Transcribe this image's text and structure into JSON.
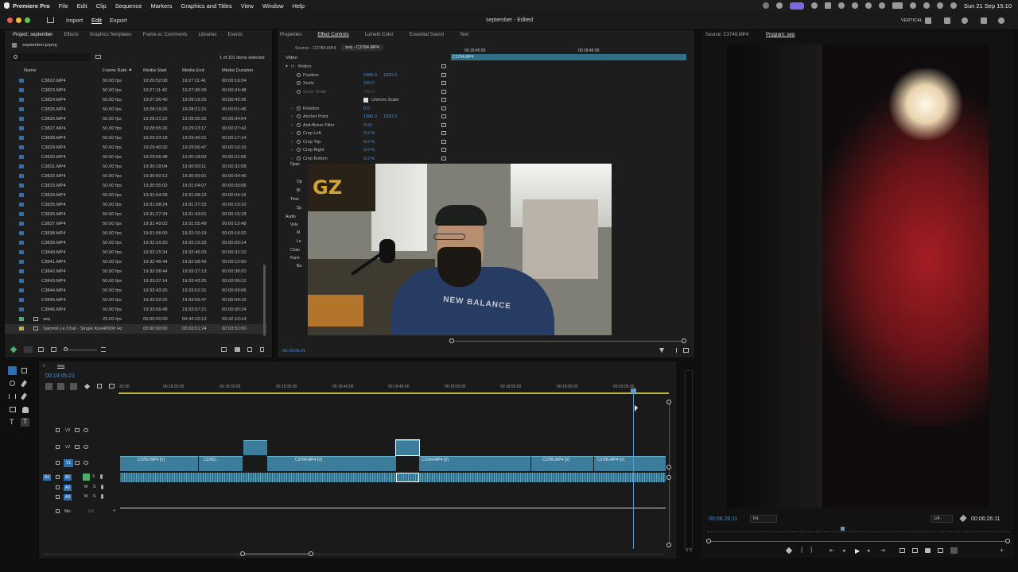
{
  "menubar": {
    "app": "Premiere Pro",
    "items": [
      "File",
      "Edit",
      "Clip",
      "Sequence",
      "Markers",
      "Graphics and Titles",
      "View",
      "Window",
      "Help"
    ],
    "clock": "Sun 21 Sep  15:10"
  },
  "titlebar": {
    "nav": [
      "Import",
      "Edit",
      "Export"
    ],
    "title": "september - Edited",
    "workspace": "VERTICAL"
  },
  "project": {
    "tabs": [
      "Project: september",
      "Effects",
      "Graphics Templates",
      "Frame.io: Comments",
      "Libraries",
      "Events"
    ],
    "file": "september.prproj",
    "count": "1 of 101 items selected",
    "columns": [
      "Name",
      "Frame Rate",
      "Media Start",
      "Media End",
      "Media Duration"
    ],
    "rows": [
      [
        "C3822.MP4",
        "50.00 fps",
        "19:26:52:08",
        "19:27:11:41",
        "00:00:19:34"
      ],
      [
        "C3823.MP4",
        "50.00 fps",
        "19:27:11:42",
        "19:27:36:39",
        "00:00:24:48"
      ],
      [
        "C3824.MP4",
        "50.00 fps",
        "19:27:36:40",
        "19:28:19:25",
        "00:00:42:36"
      ],
      [
        "C3825.MP4",
        "50.00 fps",
        "19:28:19:26",
        "19:28:21:21",
        "00:00:01:46"
      ],
      [
        "C3826.MP4",
        "50.00 fps",
        "19:28:21:22",
        "19:28:55:25",
        "00:00:34:04"
      ],
      [
        "C3827.MP4",
        "50.00 fps",
        "19:28:55:26",
        "19:29:23:17",
        "00:00:27:42"
      ],
      [
        "C3828.MP4",
        "50.00 fps",
        "19:29:23:18",
        "19:29:40:31",
        "00:00:17:14"
      ],
      [
        "C3829.MP4",
        "50.00 fps",
        "19:29:40:32",
        "19:29:56:47",
        "00:00:16:16"
      ],
      [
        "C3830.MP4",
        "50.00 fps",
        "19:29:56:48",
        "19:30:18:03",
        "00:00:21:06"
      ],
      [
        "C3831.MP4",
        "50.00 fps",
        "19:30:18:04",
        "19:30:50:11",
        "00:00:32:08"
      ],
      [
        "C3832.MP4",
        "50.00 fps",
        "19:30:50:12",
        "19:30:55:01",
        "00:00:04:40"
      ],
      [
        "C3833.MP4",
        "50.00 fps",
        "19:30:55:02",
        "19:31:04:07",
        "00:00:09:06"
      ],
      [
        "C3834.MP4",
        "50.00 fps",
        "19:31:04:08",
        "19:31:08:23",
        "00:00:04:16"
      ],
      [
        "C3835.MP4",
        "50.00 fps",
        "19:31:08:24",
        "19:31:27:33",
        "00:00:19:10"
      ],
      [
        "C3836.MP4",
        "50.00 fps",
        "19:31:27:34",
        "19:31:43:01",
        "00:00:15:18"
      ],
      [
        "C3837.MP4",
        "50.00 fps",
        "19:31:43:02",
        "19:31:55:49",
        "00:00:12:48"
      ],
      [
        "C3838.MP4",
        "50.00 fps",
        "19:31:56:00",
        "19:32:10:19",
        "00:00:14:20"
      ],
      [
        "C3839.MP4",
        "50.00 fps",
        "19:32:10:20",
        "19:32:15:33",
        "00:00:05:14"
      ],
      [
        "C3840.MP4",
        "50.00 fps",
        "19:32:15:34",
        "19:32:46:33",
        "00:00:31:10"
      ],
      [
        "C3841.MP4",
        "50.00 fps",
        "19:32:46:44",
        "19:32:58:43",
        "00:00:12:00"
      ],
      [
        "C3842.MP4",
        "50.00 fps",
        "19:32:58:44",
        "19:33:37:13",
        "00:00:38:20"
      ],
      [
        "C3843.MP4",
        "50.00 fps",
        "19:33:37:14",
        "19:33:43:25",
        "00:00:06:12"
      ],
      [
        "C3844.MP4",
        "50.00 fps",
        "19:33:43:26",
        "19:33:52:31",
        "00:00:09:06"
      ],
      [
        "C3845.MP4",
        "50.00 fps",
        "19:33:52:32",
        "19:33:56:47",
        "00:00:04:16"
      ],
      [
        "C3846.MP4",
        "50.00 fps",
        "19:33:56:48",
        "19:33:57:21",
        "00:00:00:24"
      ],
      [
        "seq",
        "25.00 fps",
        "00:00:00:00",
        "00:42:10:13",
        "00:42:10:14"
      ],
      [
        "Salomé Le Chat - Single Kiss",
        "48000 Hz",
        "00:00:00:00",
        "00:03:51:24",
        "00:03:52:00"
      ]
    ]
  },
  "effects": {
    "tabs": [
      "Properties",
      "Effect Controls",
      "Lumetri Color",
      "Essential Sound",
      "Text"
    ],
    "source": "Source - C3784.MP4",
    "seqclip": "seq - C3784.MP4",
    "ruler": [
      "00:18:45:00",
      "00:18:46:00"
    ],
    "clipname": "C3784.MP4",
    "video": "Video",
    "motion": "Motion",
    "params": [
      {
        "name": "Position",
        "v1": "1080.0",
        "v2": "1920.0"
      },
      {
        "name": "Scale",
        "v1": "100.0",
        "v2": ""
      },
      {
        "name": "Scale Width",
        "v1": "100.0",
        "v2": ""
      },
      {
        "name": "Uniform Scale",
        "v1": "",
        "v2": ""
      },
      {
        "name": "Rotation",
        "v1": "0.0",
        "v2": ""
      },
      {
        "name": "Anchor Point",
        "v1": "1080.0",
        "v2": "1920.0"
      },
      {
        "name": "Anti-flicker Filter",
        "v1": "0.00",
        "v2": ""
      },
      {
        "name": "Crop Left",
        "v1": "0.0 %",
        "v2": ""
      },
      {
        "name": "Crop Top",
        "v1": "0.0 %",
        "v2": ""
      },
      {
        "name": "Crop Right",
        "v1": "0.0 %",
        "v2": ""
      },
      {
        "name": "Crop Bottom",
        "v1": "0.0 %",
        "v2": ""
      }
    ],
    "lower": [
      "Opac",
      "Op",
      "Bl",
      "Time",
      "Sp",
      "Audio",
      "Volu",
      "M",
      "Le",
      "Chan",
      "Pann",
      "Ba"
    ],
    "timecode": "00:19:05:21"
  },
  "timeline": {
    "tab": "seq",
    "timecode": "00:19:05:21",
    "ruler": [
      "00:18:25:00",
      "00:18:30:00",
      "00:18:35:00",
      "00:18:40:00",
      "00:18:45:00",
      "00:18:50:00",
      "00:18:55:00",
      "00:19:00:00",
      "00:19:05:00"
    ],
    "ruler_start": "20:00",
    "tracks_video": [
      "V3",
      "V2",
      "V1"
    ],
    "tracks_audio": [
      "A1",
      "A2",
      "A3"
    ],
    "mix": "Mix",
    "mix_value": "0.0",
    "clips": [
      "C3782.MP4 [V]",
      "C3783...",
      "C3784.MP4 [V]",
      "C3784.MP4 [V]",
      "C3785.MP4 [V]",
      "C3786.MP4 [V]"
    ]
  },
  "program": {
    "tabs": [
      "Source: C3749.MP4",
      "Program: seq"
    ],
    "timecode_left": "00:06:26:11",
    "fit": "Fit",
    "quality": "1/4",
    "timecode_right": "00:06:26:11"
  },
  "colors": {
    "accent": "#4a8fd8",
    "clip": "#3d7d9c",
    "playhead": "#5c9ad6"
  }
}
